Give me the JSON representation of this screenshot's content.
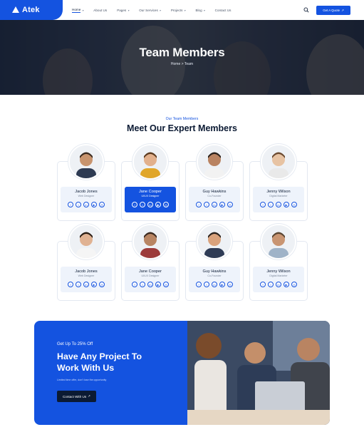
{
  "header": {
    "logo_text": "Atek",
    "nav": [
      {
        "label": "Home",
        "caret": "▾",
        "active": true
      },
      {
        "label": "About Us",
        "caret": "",
        "active": false
      },
      {
        "label": "Pages",
        "caret": "▾",
        "active": false
      },
      {
        "label": "Our Services",
        "caret": "▾",
        "active": false
      },
      {
        "label": "Projects",
        "caret": "▾",
        "active": false
      },
      {
        "label": "Blog",
        "caret": "▾",
        "active": false
      },
      {
        "label": "Contact Us",
        "caret": "",
        "active": false
      }
    ],
    "cta_label": "Get A Quote",
    "cta_arrow": "↗"
  },
  "hero": {
    "title": "Team Members",
    "breadcrumb": "Home  >  Team"
  },
  "section": {
    "eyebrow": "Our Team Members",
    "title": "Meet Our Expert Members"
  },
  "team": [
    {
      "name": "Jacob Jones",
      "role": "Web Designer",
      "highlight": false
    },
    {
      "name": "Jane Cooper",
      "role": "UI/UX Designer",
      "highlight": true
    },
    {
      "name": "Guy Hawkins",
      "role": "Co-Founder",
      "highlight": false
    },
    {
      "name": "Jenny Wilson",
      "role": "Digital Marketer",
      "highlight": false
    },
    {
      "name": "Jacob Jones",
      "role": "Web Designer",
      "highlight": false
    },
    {
      "name": "Jane Cooper",
      "role": "UI/UX Designer",
      "highlight": false
    },
    {
      "name": "Guy Hawkins",
      "role": "Co-Founder",
      "highlight": false
    },
    {
      "name": "Jenny Wilson",
      "role": "Digital Marketer",
      "highlight": false
    }
  ],
  "social_icons": [
    "f",
    "t",
    "in",
    "▶",
    "◎"
  ],
  "cta": {
    "eyebrow": "Get Up To 25% Off",
    "title_line1": "Have Any Project To",
    "title_line2": "Work With Us",
    "description": "Limited time offer, don't lose the opportunity",
    "button_label": "Contact With Us",
    "button_arrow": "↗"
  },
  "colors": {
    "brand": "#1453e0",
    "dark": "#0b1a33",
    "card_info": "#eef3fb"
  }
}
